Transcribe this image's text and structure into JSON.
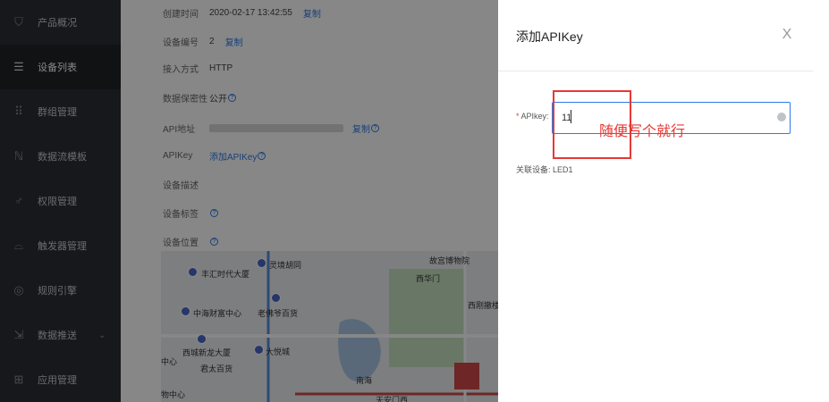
{
  "sidebar": {
    "items": [
      {
        "label": "产品概况",
        "icon": "product-icon"
      },
      {
        "label": "设备列表",
        "icon": "list-icon",
        "active": true
      },
      {
        "label": "群组管理",
        "icon": "grid-icon"
      },
      {
        "label": "数据流模板",
        "icon": "flow-icon"
      },
      {
        "label": "权限管理",
        "icon": "key-icon"
      },
      {
        "label": "触发器管理",
        "icon": "trigger-icon"
      },
      {
        "label": "规则引擎",
        "icon": "rule-icon"
      },
      {
        "label": "数据推送",
        "icon": "push-icon",
        "chevron": "⌄"
      },
      {
        "label": "应用管理",
        "icon": "apps-icon"
      }
    ]
  },
  "device": {
    "created_label": "创建时间",
    "created_value": "2020-02-17 13:42:55",
    "copy_label": "复制",
    "id_label": "设备编号",
    "id_value": "2",
    "access_label": "接入方式",
    "access_value": "HTTP",
    "privacy_label": "数据保密性",
    "privacy_value": "公开",
    "api_address_label": "API地址",
    "apikey_label": "APIKey",
    "apikey_link": "添加APIKey",
    "desc_label": "设备描述",
    "tags_label": "设备标签",
    "location_label": "设备位置"
  },
  "map": {
    "labels": [
      "丰汇时代大厦",
      "灵境胡同",
      "故宫博物院",
      "西华门",
      "中海财富中心",
      "老佛爷百货",
      "西刚撤楼",
      "西城新龙大厦",
      "大悦城",
      "君太百货",
      "中心",
      "南海",
      "天安门西",
      "物中心"
    ]
  },
  "drawer": {
    "title": "添加APIKey",
    "close": "X",
    "field_label": "APIkey:",
    "field_value": "11",
    "device_label": "关联设备:",
    "device_value": "LED1"
  },
  "annotation": {
    "text": "随便写个就行",
    "color": "#e53935"
  },
  "colors": {
    "accent": "#2d7be5",
    "sidebar_bg": "#2b2e33"
  }
}
